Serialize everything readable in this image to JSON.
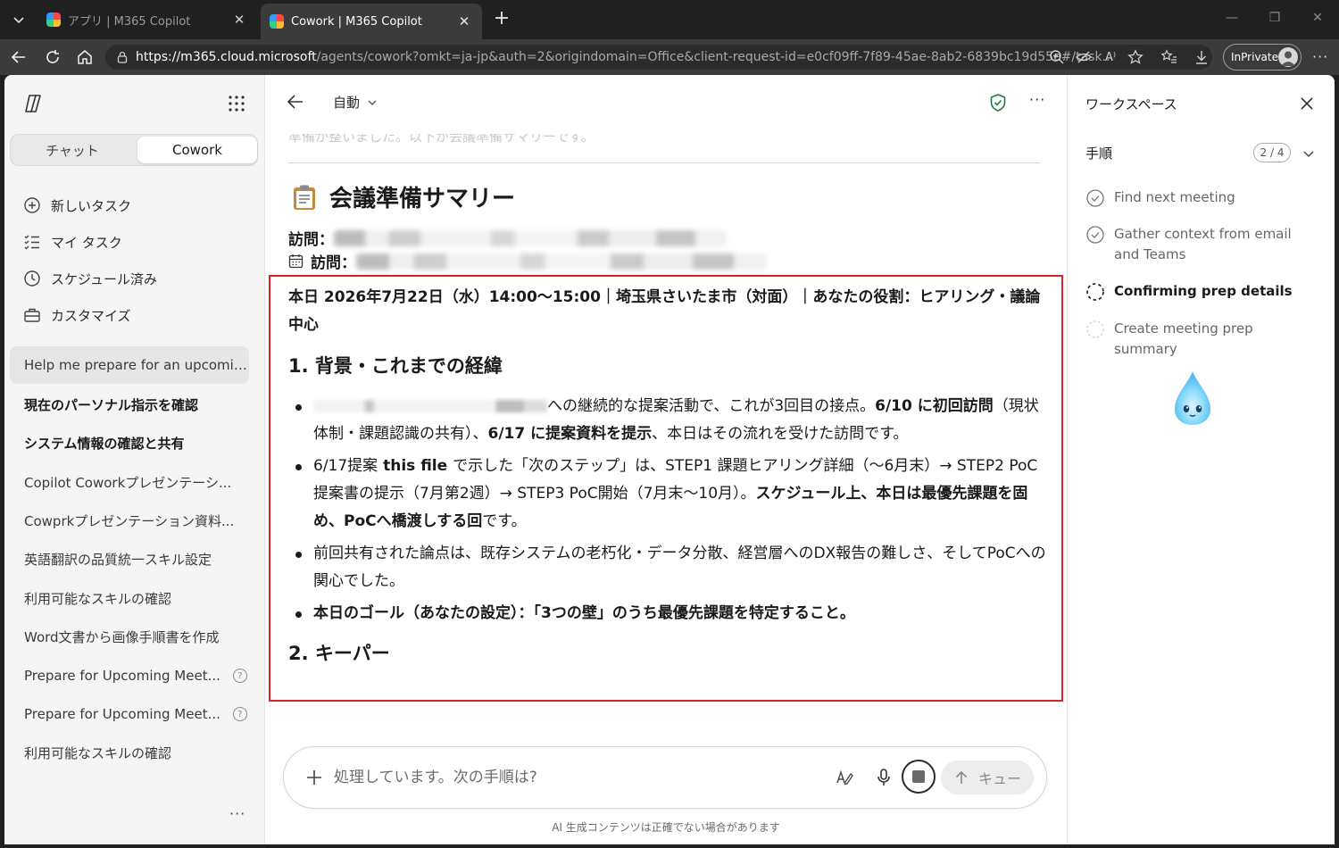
{
  "browser": {
    "tabs": [
      {
        "title": "アプリ | M365 Copilot",
        "active": false
      },
      {
        "title": "Cowork | M365 Copilot",
        "active": true
      }
    ],
    "url_host": "https://m365.cloud.microsoft",
    "url_rest": "/agents/cowork?omkt=ja-jp&auth=2&origindomain=Office&client-request-id=e0cf09ff-7f89-45ae-8ab2-6839bc19d55e#/task...",
    "inprivate_label": "InPrivate",
    "colors": {
      "chrome_dark": "#202020",
      "tab_active": "#3b3b3b"
    }
  },
  "sidebar": {
    "modes": [
      {
        "label": "チャット"
      },
      {
        "label": "Cowork"
      }
    ],
    "active_mode": "Cowork",
    "nav": [
      {
        "label": "新しいタスク",
        "icon": "plus-circle-icon"
      },
      {
        "label": "マイ タスク",
        "icon": "task-list-icon"
      },
      {
        "label": "スケジュール済み",
        "icon": "clock-icon"
      },
      {
        "label": "カスタマイズ",
        "icon": "briefcase-icon"
      }
    ],
    "history": [
      {
        "label": "Help me prepare for an upcomin...",
        "selected": true,
        "bold": false
      },
      {
        "label": "現在のパーソナル指示を確認",
        "bold": true
      },
      {
        "label": "システム情報の確認と共有",
        "bold": true
      },
      {
        "label": "Copilot Coworkプレゼンテーシ...",
        "bold": false
      },
      {
        "label": "Cowprkプレゼンテーション資料...",
        "bold": false
      },
      {
        "label": "英語翻訳の品質統一スキル設定",
        "bold": false
      },
      {
        "label": "利用可能なスキルの確認",
        "bold": false
      },
      {
        "label": "Word文書から画像手順書を作成",
        "bold": false
      },
      {
        "label": "Prepare for Upcoming Meet...",
        "bold": false,
        "badge": "?"
      },
      {
        "label": "Prepare for Upcoming Meet...",
        "bold": false,
        "badge": "?"
      },
      {
        "label": "利用可能なスキルの確認",
        "bold": false
      }
    ]
  },
  "main": {
    "mode_label": "自動",
    "faded_text": "準備が整いました。以下が会議準備サマリーです。",
    "summary_title": "会議準備サマリー",
    "visit_label_1": "訪問：",
    "visit_label_2": "訪問：",
    "date_line": {
      "a": "本日 2026年7月22日（水）14:00〜15:00｜埼玉県さいたま市（対面）｜あなたの役割：ヒアリング・議論中心"
    },
    "section1_heading": "1. 背景・これまでの経緯",
    "bullets": [
      {
        "t1": "への継続的な提案活動で、これが3回目の接点。",
        "b1": "6/10 に初回訪問",
        "t2": "（現状体制・課題認識の共有）、",
        "b2": "6/17 に提案資料を提示",
        "t3": "、本日はその流れを受けた訪問です。"
      },
      {
        "t1": "6/17提案",
        "b1": " this file ",
        "t2": "で示した「次のステップ」は、STEP1 課題ヒアリング詳細（〜6月末）→ STEP2 PoC提案書の提示（7月第2週）→ STEP3 PoC開始（7月末〜10月）。",
        "b2": "スケジュール上、本日は最優先課題を固め、PoCへ橋渡しする回",
        "t3": "です。"
      },
      {
        "t1": "前回共有された論点は、既存システムの老朽化・データ分散、経営層へのDX報告の難しさ、そしてPoCへの関心でした。"
      },
      {
        "b1": "本日のゴール（あなたの設定）：「3つの壁」のうち最優先課題を特定すること。"
      }
    ],
    "section2_heading": "2. キーパー",
    "composer": {
      "placeholder": "処理しています。次の手順は?",
      "queue_label": "キュー"
    },
    "disclaimer": "AI 生成コンテンツは正確でない場合があります",
    "colors": {
      "highlight_box": "#d6232b"
    }
  },
  "workspace": {
    "title": "ワークスペース",
    "steps_label": "手順",
    "progress": "2 / 4",
    "steps": [
      {
        "label": "Find next meeting",
        "status": "done"
      },
      {
        "label": "Gather context from email and Teams",
        "status": "done"
      },
      {
        "label": "Confirming prep details",
        "status": "active"
      },
      {
        "label": "Create meeting prep summary",
        "status": "pending"
      }
    ]
  }
}
